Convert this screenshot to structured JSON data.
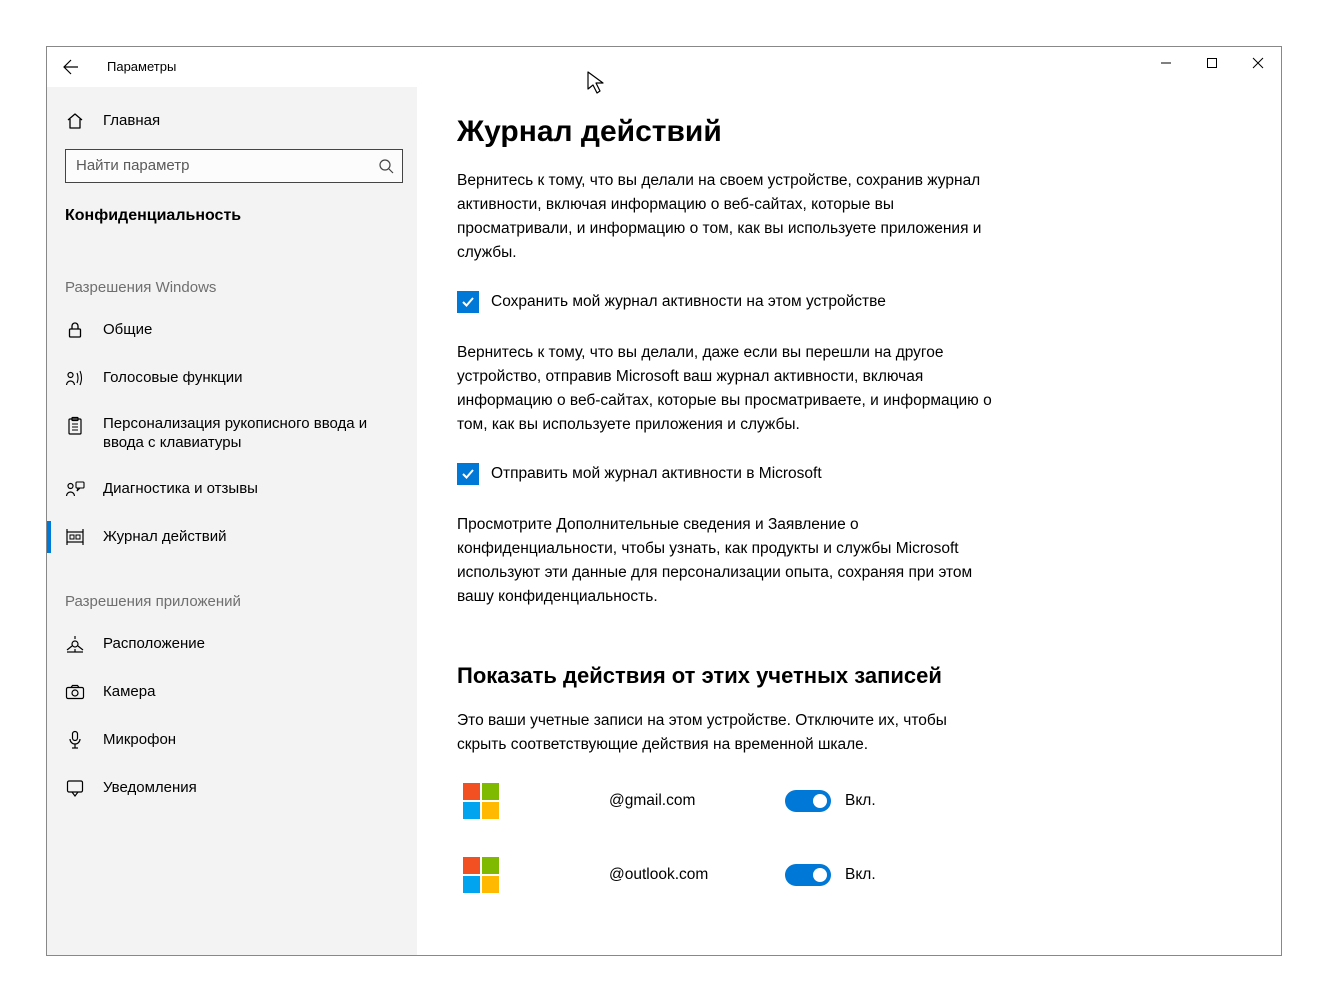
{
  "window": {
    "title": "Параметры"
  },
  "sidebar": {
    "home": "Главная",
    "search_placeholder": "Найти параметр",
    "category": "Конфиденциальность",
    "section1": "Разрешения Windows",
    "section2": "Разрешения приложений",
    "items_win": [
      {
        "label": "Общие"
      },
      {
        "label": "Голосовые функции"
      },
      {
        "label": "Персонализация рукописного ввода и ввода с клавиатуры"
      },
      {
        "label": "Диагностика и отзывы"
      },
      {
        "label": "Журнал действий"
      }
    ],
    "items_app": [
      {
        "label": "Расположение"
      },
      {
        "label": "Камера"
      },
      {
        "label": "Микрофон"
      },
      {
        "label": "Уведомления"
      }
    ]
  },
  "main": {
    "title": "Журнал действий",
    "para1": "Вернитесь к тому, что вы делали на своем устройстве, сохранив журнал активности, включая информацию о веб-сайтах, которые вы просматривали, и информацию о том, как вы используете приложения и службы.",
    "check1": "Сохранить мой журнал активности на этом устройстве",
    "para2": "Вернитесь к тому, что вы делали, даже если вы перешли на другое устройство, отправив Microsoft ваш журнал активности, включая информацию о веб-сайтах, которые вы просматриваете, и информацию о том, как вы используете приложения и службы.",
    "check2": "Отправить мой журнал активности в Microsoft",
    "para3": "Просмотрите Дополнительные сведения и Заявление о конфиденциальности, чтобы узнать, как продукты и службы Microsoft используют эти данные для персонализации опыта, сохраняя при этом вашу конфиденциальность.",
    "sub_title": "Показать действия от этих учетных записей",
    "para4": "Это ваши учетные записи на этом устройстве. Отключите их, чтобы скрыть соответствующие действия на временной шкале.",
    "accounts": [
      {
        "name": "@gmail.com",
        "state": "Вкл."
      },
      {
        "name": "@outlook.com",
        "state": "Вкл."
      }
    ]
  },
  "colors": {
    "accent": "#0078d7",
    "ms_red": "#f25022",
    "ms_green": "#7fba00",
    "ms_blue": "#00a4ef",
    "ms_yellow": "#ffb900"
  }
}
